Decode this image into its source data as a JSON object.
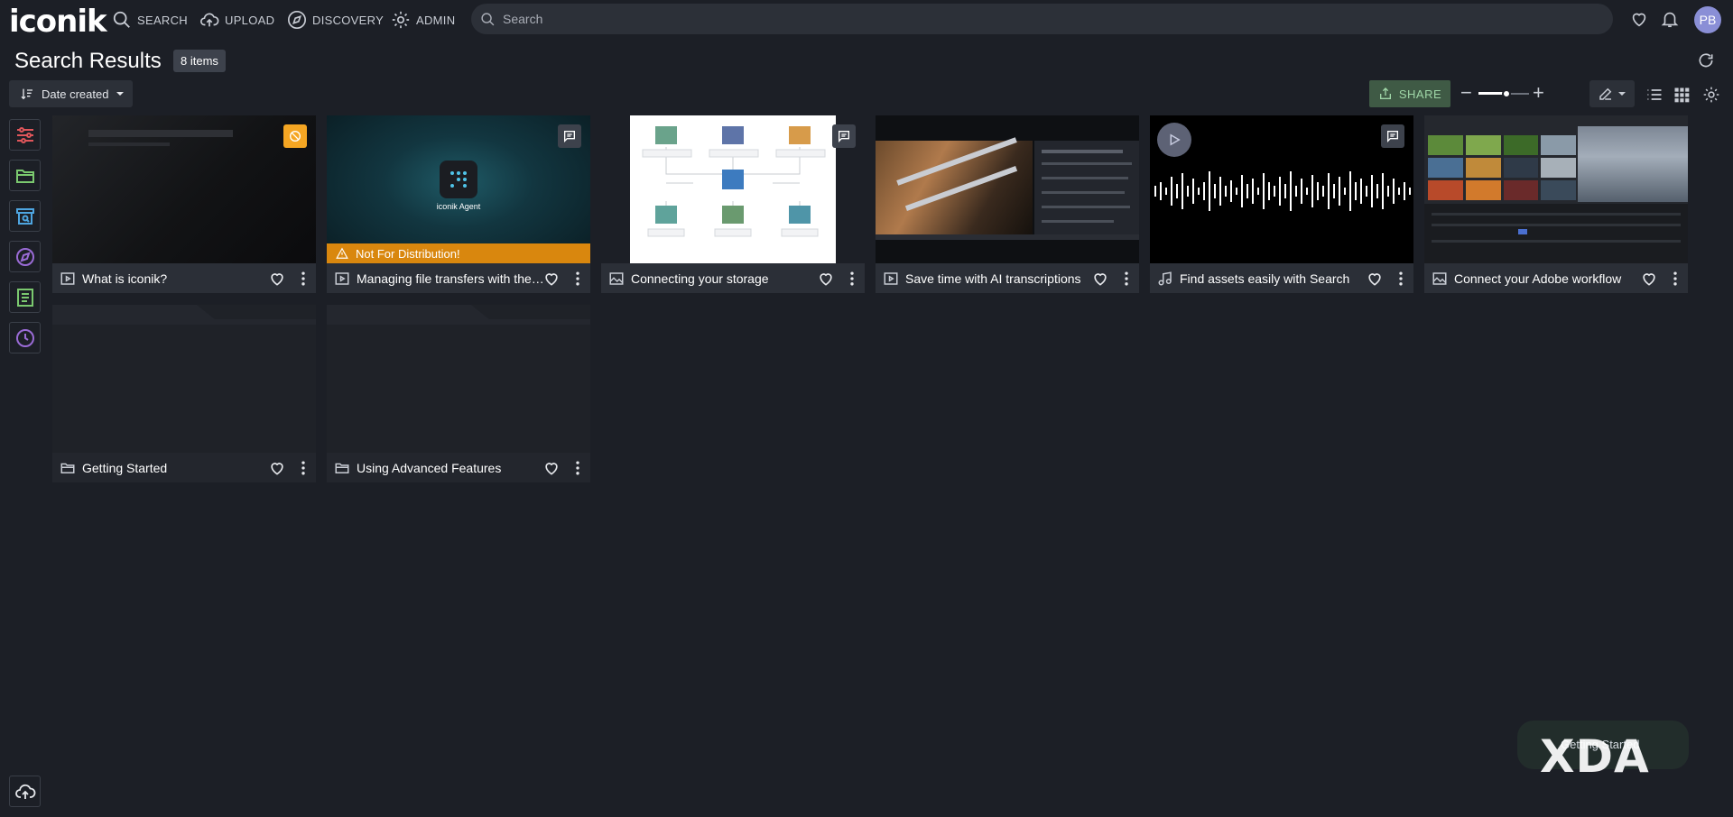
{
  "app": {
    "logo": "iconik"
  },
  "nav": {
    "search": "SEARCH",
    "upload": "UPLOAD",
    "discovery": "DISCOVERY",
    "admin": "ADMIN"
  },
  "search": {
    "placeholder": "Search"
  },
  "user": {
    "initials": "PB"
  },
  "header": {
    "title": "Search Results",
    "count": "8 items"
  },
  "toolbar": {
    "sort_label": "Date created",
    "share_label": "SHARE",
    "zoom_level": 0.55
  },
  "colors": {
    "accent_orange": "#d9870e",
    "share_green": "#3f5a45",
    "rail_red": "#e0565b",
    "rail_green": "#7bc96f",
    "rail_blue": "#4ea5e0",
    "rail_purple": "#9a6bd6"
  },
  "assets": [
    {
      "title": "What is iconik?",
      "type": "video-icon"
    },
    {
      "title": "Managing file transfers with the iconik Agent",
      "type": "video-icon",
      "warning": "Not For Distribution!",
      "thumb_text": "iconik Agent"
    },
    {
      "title": "Connecting your storage",
      "type": "image-icon"
    },
    {
      "title": "Save time with AI transcriptions",
      "type": "video-icon"
    },
    {
      "title": "Find assets easily with Search",
      "type": "audio-icon"
    },
    {
      "title": "Connect your Adobe workflow",
      "type": "image-icon"
    }
  ],
  "folders": [
    {
      "title": "Getting Started",
      "type": "folder-icon"
    },
    {
      "title": "Using Advanced Features",
      "type": "folder-icon"
    }
  ],
  "toast": {
    "label": "Getting Started"
  },
  "watermark": {
    "text": "XDA"
  }
}
